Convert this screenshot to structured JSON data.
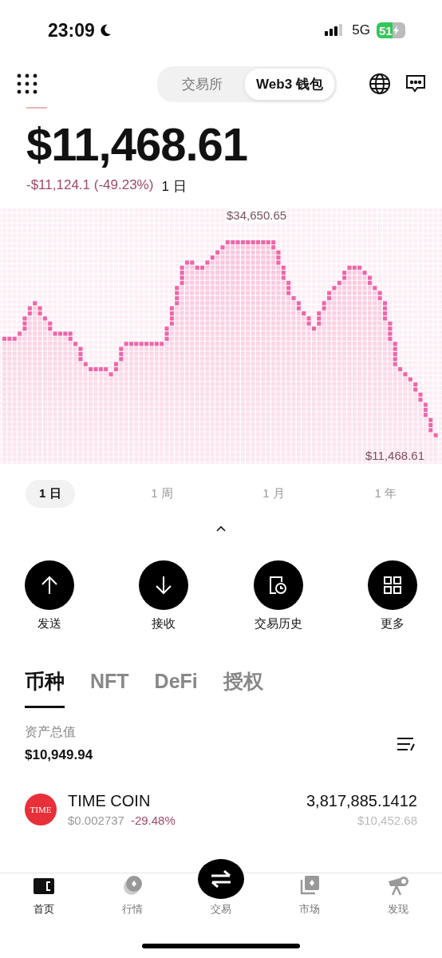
{
  "status_bar": {
    "time": "23:09",
    "network": "5G",
    "battery": "51"
  },
  "header": {
    "segments": [
      {
        "label": "交易所",
        "selected": false
      },
      {
        "label": "Web3 钱包",
        "selected": true
      }
    ]
  },
  "balance": {
    "amount": "$11,468.61",
    "change": "-$11,124.1 (-49.23%)",
    "period": "1 日"
  },
  "chart": {
    "high_label": "$34,650.65",
    "low_label": "$11,468.61"
  },
  "periods": [
    {
      "label": "1 日",
      "selected": true
    },
    {
      "label": "1 周",
      "selected": false
    },
    {
      "label": "1 月",
      "selected": false
    },
    {
      "label": "1 年",
      "selected": false
    }
  ],
  "actions": [
    {
      "label": "发送",
      "kind": "send"
    },
    {
      "label": "接收",
      "kind": "receive"
    },
    {
      "label": "交易历史",
      "kind": "history"
    },
    {
      "label": "更多",
      "kind": "more"
    }
  ],
  "asset_tabs": [
    {
      "label": "币种",
      "selected": true
    },
    {
      "label": "NFT",
      "selected": false
    },
    {
      "label": "DeFi",
      "selected": false
    },
    {
      "label": "授权",
      "selected": false
    }
  ],
  "total": {
    "label": "资产总值",
    "value": "$10,949.94"
  },
  "tokens": [
    {
      "logo_text": "TIME",
      "name": "TIME COIN",
      "price": "$0.002737",
      "change": "-29.48%",
      "amount": "3,817,885.1412",
      "value": "$10,452.68"
    }
  ],
  "nav": [
    {
      "label": "首页",
      "kind": "home",
      "selected": true
    },
    {
      "label": "行情",
      "kind": "markets",
      "selected": false
    },
    {
      "label": "交易",
      "kind": "trade",
      "selected": false
    },
    {
      "label": "市场",
      "kind": "marketplace",
      "selected": false
    },
    {
      "label": "发现",
      "kind": "discover",
      "selected": false
    }
  ]
}
